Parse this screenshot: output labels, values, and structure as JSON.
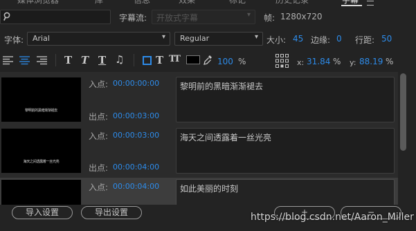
{
  "tabs": [
    "媒体浏览器",
    "库",
    "信息",
    "效果",
    "标记",
    "历史记录",
    "字幕"
  ],
  "search": {
    "placeholder": ""
  },
  "caption_stream": {
    "label": "字幕流:",
    "value": "开放式字幕"
  },
  "frame": {
    "label": "帧:",
    "value": "1280x720"
  },
  "font": {
    "label": "字体:",
    "family": "Arial",
    "style": "Regular"
  },
  "size": {
    "label": "大小:",
    "value": "45"
  },
  "edge": {
    "label": "边缘:",
    "value": "0"
  },
  "line_spacing": {
    "label": "行距:",
    "value": "50"
  },
  "opacity": {
    "value": "100",
    "unit": "%"
  },
  "position": {
    "x_label": "x:",
    "x": "31.84",
    "y_label": "y:",
    "y": "88.19",
    "unit": "%"
  },
  "colors": {
    "accent": "#2d8ceb",
    "swatch": "#000000"
  },
  "captions": [
    {
      "in_label": "入点:",
      "in": "00:00:00:00",
      "out_label": "出点:",
      "out": "00:00:03:00",
      "text": "黎明前的黑暗渐渐褪去",
      "preview": "黎明前的黑暗渐渐褪去"
    },
    {
      "in_label": "入点:",
      "in": "00:00:03:00",
      "out_label": "出点:",
      "out": "00:00:04:00",
      "text": "海天之间透露着一丝光亮",
      "preview": "海天之间透露着一丝光亮"
    },
    {
      "in_label": "入点:",
      "in": "00:00:04:00",
      "out_label": "",
      "out": "",
      "text": "如此美丽的时刻",
      "preview": ""
    }
  ],
  "buttons": {
    "import": "导入设置",
    "export": "导出设置",
    "add": "+",
    "remove": "−"
  },
  "watermark": "https://blog.csdn.net/Aaron_Miller"
}
